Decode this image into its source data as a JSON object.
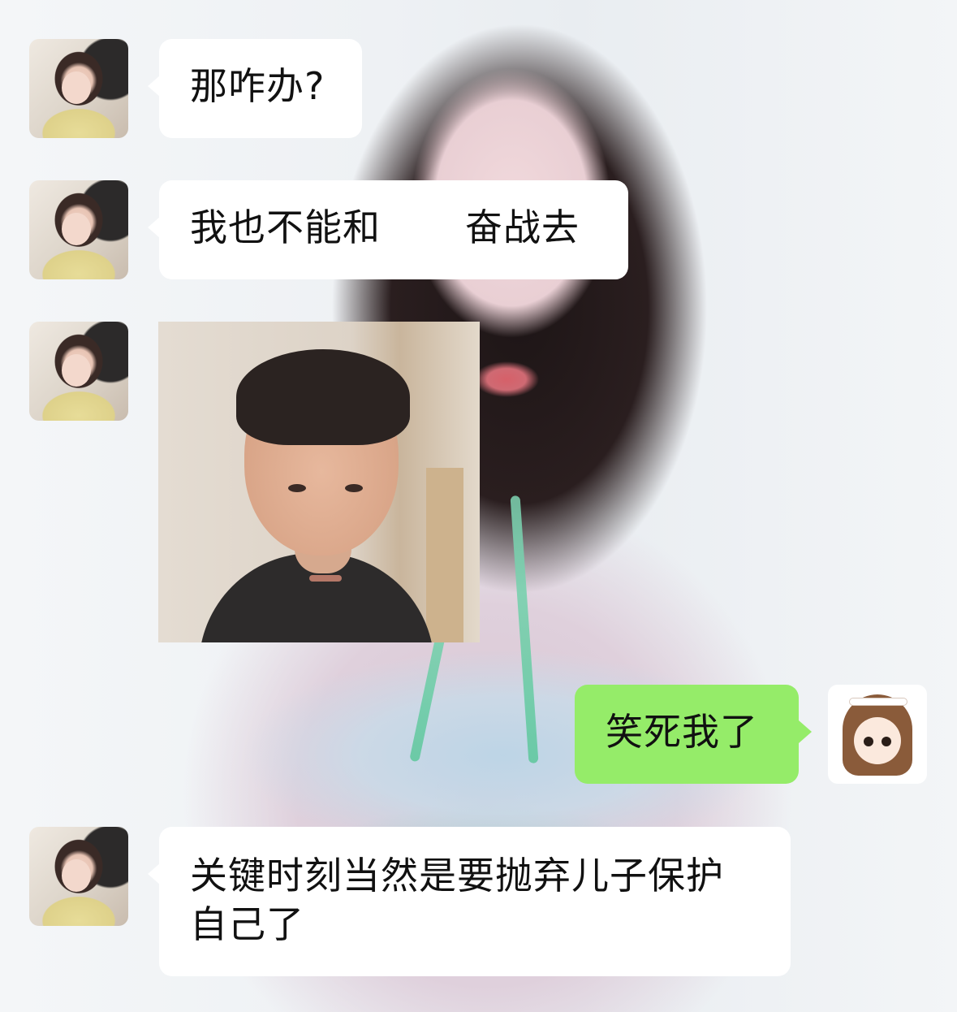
{
  "messages": [
    {
      "sender": "other",
      "text": "那咋办?"
    },
    {
      "sender": "other",
      "text_before": "我也不能和",
      "text_after": "奋战去"
    },
    {
      "sender": "other",
      "type": "image"
    },
    {
      "sender": "me",
      "text": "笑死我了"
    },
    {
      "sender": "other",
      "text": "关键时刻当然是要抛弃儿子保护自己了"
    }
  ],
  "colors": {
    "sent_bubble": "#95ec69",
    "received_bubble": "#ffffff",
    "text": "#111111"
  }
}
